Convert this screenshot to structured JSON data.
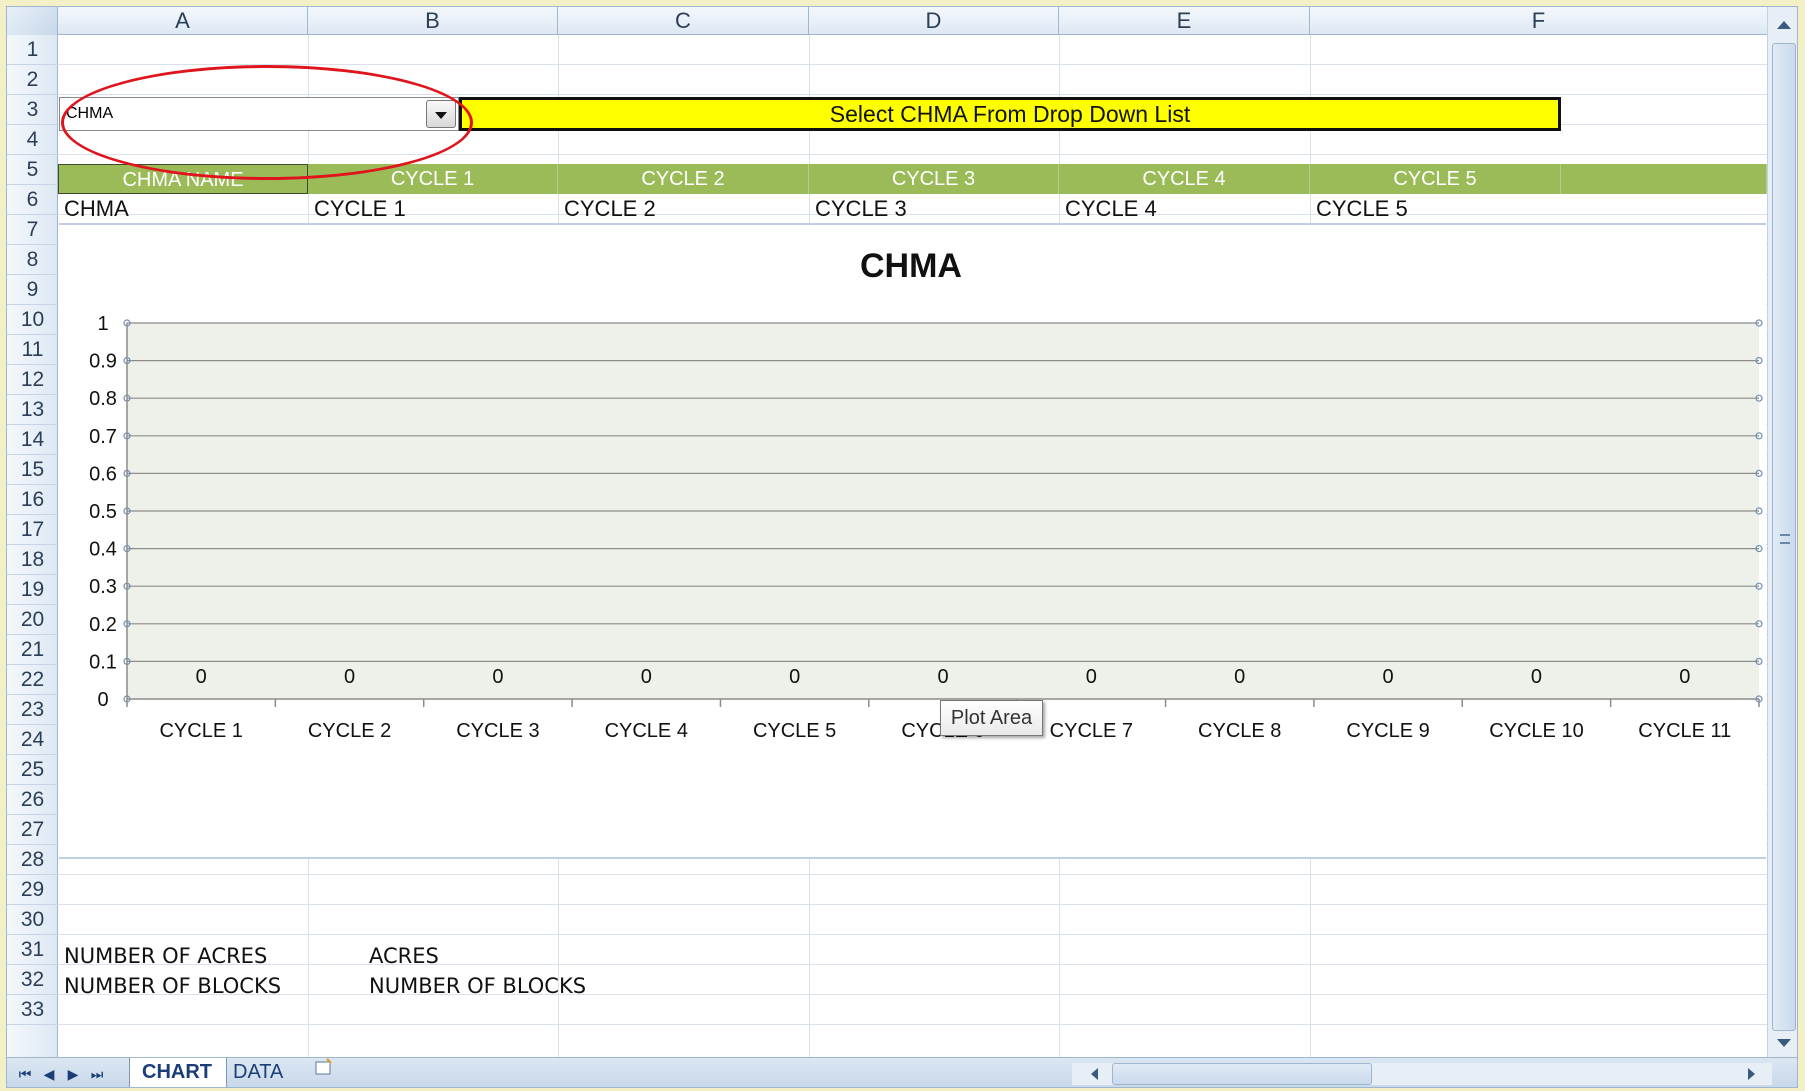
{
  "columns": [
    "A",
    "B",
    "C",
    "D",
    "E",
    "F"
  ],
  "rows": [
    "1",
    "2",
    "3",
    "4",
    "5",
    "6",
    "7",
    "8",
    "9",
    "10",
    "11",
    "12",
    "13",
    "14",
    "15",
    "16",
    "17",
    "18",
    "19",
    "20",
    "21",
    "22",
    "23",
    "24",
    "25",
    "26",
    "27",
    "28",
    "29",
    "30",
    "31",
    "32",
    "33"
  ],
  "dropdown": {
    "value": "CHMA"
  },
  "instruction": "Select CHMA From Drop Down List",
  "header_row": [
    "CHMA NAME",
    "CYCLE 1",
    "CYCLE 2",
    "CYCLE 3",
    "CYCLE 4",
    "CYCLE 5"
  ],
  "data_row": [
    "CHMA",
    "CYCLE 1",
    "CYCLE 2",
    "CYCLE 3",
    "CYCLE 4",
    "CYCLE 5"
  ],
  "footer": {
    "acres_label": "NUMBER OF ACRES",
    "acres_value": "ACRES",
    "blocks_label": "NUMBER OF BLOCKS",
    "blocks_value": "NUMBER OF BLOCKS"
  },
  "tooltip": "Plot Area",
  "sheet_tabs": {
    "chart": "CHART",
    "data": "DATA"
  },
  "colors": {
    "green_header": "#9bbb59",
    "yellow": "#ffff00",
    "highlight_circle": "#e0141c",
    "plot_bg": "#eef1e9"
  },
  "chart_data": {
    "type": "bar",
    "title": "CHMA",
    "categories": [
      "CYCLE 1",
      "CYCLE 2",
      "CYCLE 3",
      "CYCLE 4",
      "CYCLE 5",
      "CYCLE 6",
      "CYCLE 7",
      "CYCLE 8",
      "CYCLE 9",
      "CYCLE 10",
      "CYCLE 11"
    ],
    "values": [
      0,
      0,
      0,
      0,
      0,
      0,
      0,
      0,
      0,
      0,
      0
    ],
    "data_labels": [
      "0",
      "0",
      "0",
      "0",
      "0",
      "0",
      "0",
      "0",
      "0",
      "0",
      "0"
    ],
    "y_ticks": [
      "0",
      "0.1",
      "0.2",
      "0.3",
      "0.4",
      "0.5",
      "0.6",
      "0.7",
      "0.8",
      "0.9",
      "1"
    ],
    "ylim": [
      0,
      1
    ],
    "grid": true,
    "legend": "none"
  }
}
